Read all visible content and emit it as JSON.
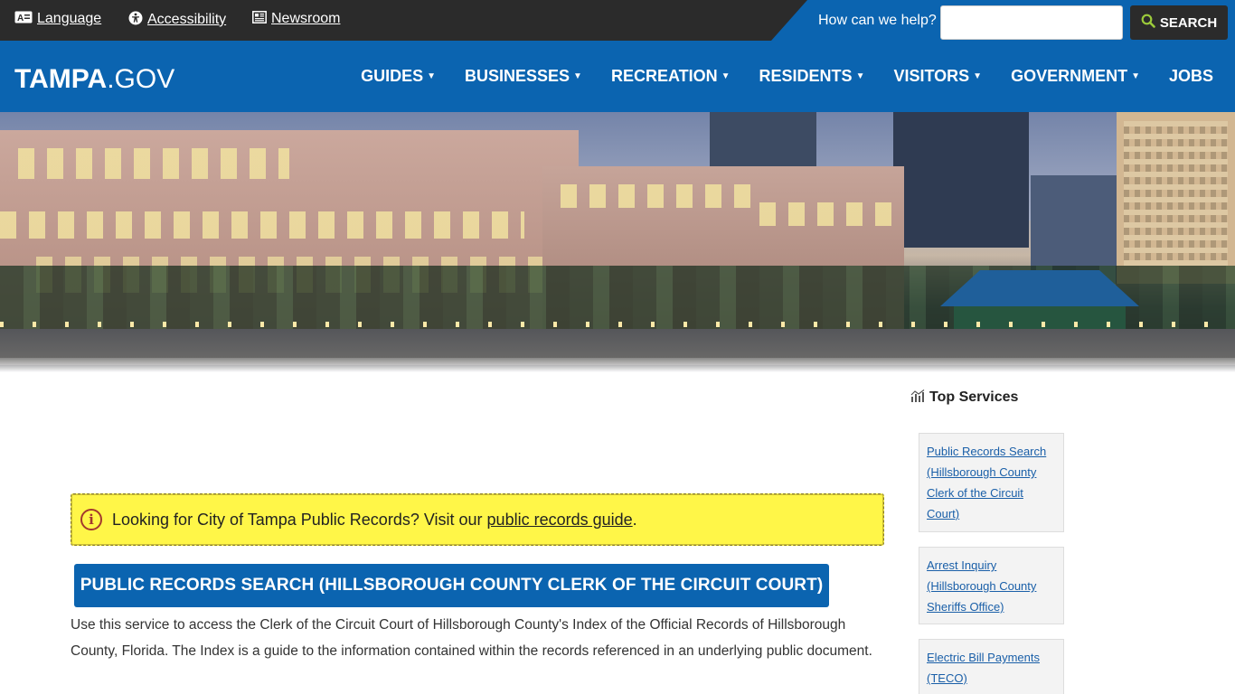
{
  "utility": {
    "links": [
      {
        "label": "Language",
        "icon": "language-icon"
      },
      {
        "label": "Accessibility",
        "icon": "accessibility-icon"
      },
      {
        "label": "Newsroom",
        "icon": "newspaper-icon"
      }
    ],
    "help_text": "How can we help?",
    "search_placeholder": "",
    "search_label": "SEARCH"
  },
  "header": {
    "logo_bold": "TAMPA",
    "logo_dot": ".",
    "logo_thin": "GOV",
    "nav": [
      {
        "label": "GUIDES"
      },
      {
        "label": "BUSINESSES"
      },
      {
        "label": "RECREATION"
      },
      {
        "label": "RESIDENTS"
      },
      {
        "label": "VISITORS"
      },
      {
        "label": "GOVERNMENT"
      }
    ],
    "jobs": "JOBS"
  },
  "main": {
    "alert_text": "Looking for City of Tampa Public Records? Visit our ",
    "alert_link": "public records guide",
    "alert_end": ".",
    "record_button": "PUBLIC RECORDS SEARCH (HILLSBOROUGH COUNTY CLERK OF THE CIRCUIT COURT)",
    "description": "Use this service to access the Clerk of the Circuit Court of Hillsborough County's Index of the Official Records of Hillsborough County, Florida. The Index is a guide to the information contained within the records referenced in an underlying public document."
  },
  "sidebar": {
    "title": "Top Services",
    "items": [
      {
        "label": "Public Records Search (Hillsborough County Clerk of the Circuit Court)"
      },
      {
        "label": "Arrest Inquiry (Hillsborough County Sheriffs Office)"
      },
      {
        "label": "Electric Bill Payments (TECO)"
      }
    ]
  },
  "colors": {
    "brand_blue": "#0b64b0",
    "utility_dark": "#2b2b2b",
    "alert_yellow": "#fff648",
    "search_icon_green": "#9ccb3b"
  }
}
